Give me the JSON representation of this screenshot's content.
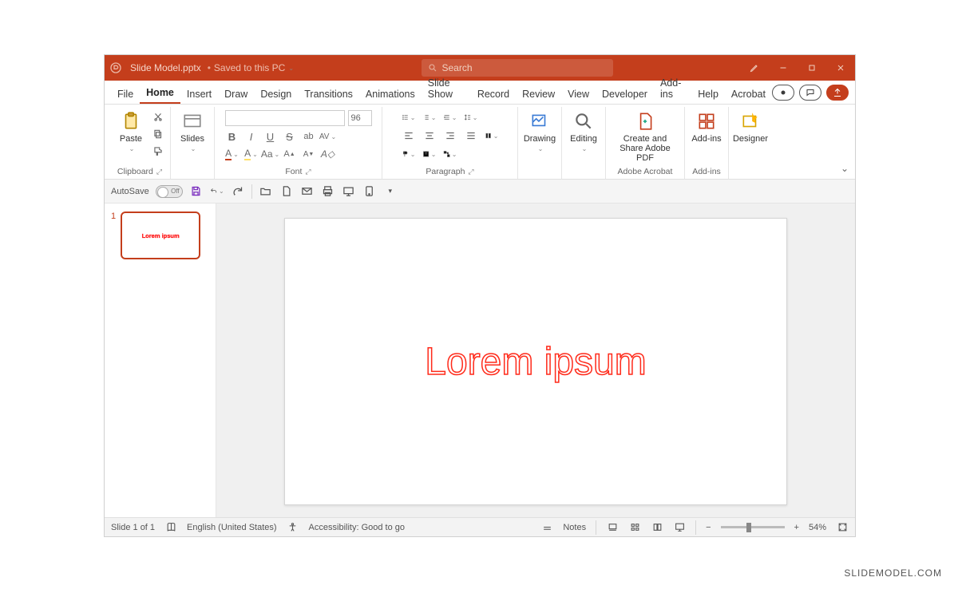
{
  "titlebar": {
    "filename": "Slide Model.pptx",
    "save_status": "Saved to this PC",
    "search_placeholder": "Search"
  },
  "tabs": [
    "File",
    "Home",
    "Insert",
    "Draw",
    "Design",
    "Transitions",
    "Animations",
    "Slide Show",
    "Record",
    "Review",
    "View",
    "Developer",
    "Add-ins",
    "Help",
    "Acrobat"
  ],
  "active_tab": "Home",
  "ribbon": {
    "paste": "Paste",
    "clipboard": "Clipboard",
    "slides": "Slides",
    "font_size": "96",
    "font_label": "Font",
    "paragraph_label": "Paragraph",
    "drawing": "Drawing",
    "editing": "Editing",
    "acrobat": "Create and Share Adobe PDF",
    "acrobat_label": "Adobe Acrobat",
    "addins": "Add-ins",
    "addins_label": "Add-ins",
    "designer": "Designer"
  },
  "qa": {
    "autosave": "AutoSave",
    "autosave_state": "Off"
  },
  "slide": {
    "thumb_number": "1",
    "text": "Lorem ipsum"
  },
  "status": {
    "slide_info": "Slide 1 of 1",
    "language": "English (United States)",
    "accessibility": "Accessibility: Good to go",
    "notes": "Notes",
    "zoom": "54%"
  },
  "watermark": "SLIDEMODEL.COM"
}
